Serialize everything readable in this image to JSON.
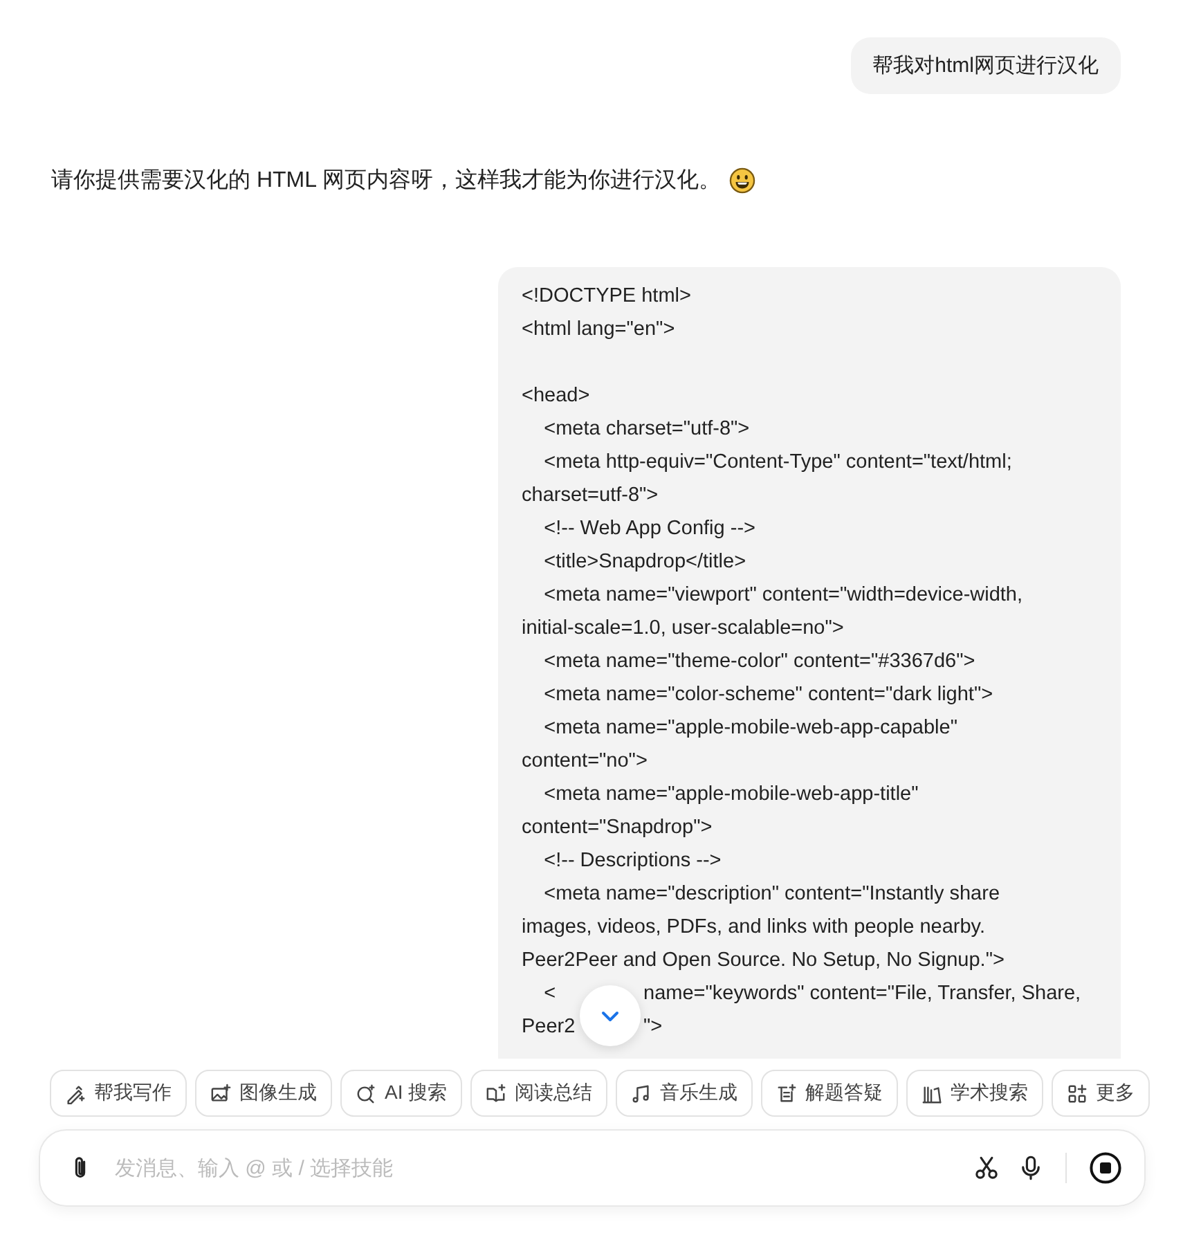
{
  "messages": [
    {
      "kind": "user_text",
      "text": "帮我对html网页进行汉化"
    },
    {
      "kind": "assistant_text",
      "text": "请你提供需要汉化的 HTML 网页内容呀，这样我才能为你进行汉化。",
      "emoji": true
    },
    {
      "kind": "user_code",
      "blocks": [
        {
          "lines": [
            [
              "<!DOCTYPE html>"
            ],
            [
              "<html lang=\"en\">"
            ]
          ]
        },
        {
          "lines": [
            [
              "<head>"
            ],
            [
              "    <meta charset=\"utf-8\">"
            ],
            [
              "    <meta http-equiv=\"Content-Type\" content=\"text/html; charset=utf-8\">"
            ],
            [
              "    <!-- Web App Config -->"
            ],
            [
              "    <title>Snapdrop</title>"
            ],
            [
              "    <meta name=\"viewport\" content=\"width=device-width, initial-scale=1.0, user-scalable=no\">"
            ],
            [
              "    <meta name=\"theme-color\" content=\"#3367d6\">"
            ],
            [
              "    <meta name=\"color-scheme\" content=\"dark light\">"
            ],
            [
              "    <meta name=\"apple-mobile-web-app-capable\" content=\"no\">"
            ],
            [
              "    <meta name=\"apple-mobile-web-app-title\" content=\"Snapdrop\">"
            ],
            [
              "    <!-- Descriptions -->"
            ],
            [
              "    <meta name=\"description\" content=\"Instantly share images, videos, PDFs, and links with people nearby. Peer2Peer and Open Source. No Setup, No Signup.\">"
            ],
            [
              "    <",
              "name=\"keywords\" content=\"File, Transfer, Share,"
            ],
            [
              "Peer2",
              "\">"
            ]
          ]
        }
      ]
    }
  ],
  "skills": [
    {
      "kind": "write",
      "label": "帮我写作"
    },
    {
      "kind": "image",
      "label": "图像生成"
    },
    {
      "kind": "search",
      "label": "AI 搜索"
    },
    {
      "kind": "read",
      "label": "阅读总结"
    },
    {
      "kind": "music",
      "label": "音乐生成"
    },
    {
      "kind": "solve",
      "label": "解题答疑"
    },
    {
      "kind": "academic",
      "label": "学术搜索"
    },
    {
      "kind": "more",
      "label": "更多"
    }
  ],
  "composer": {
    "placeholder": "发消息、输入 @ 或 / 选择技能"
  }
}
